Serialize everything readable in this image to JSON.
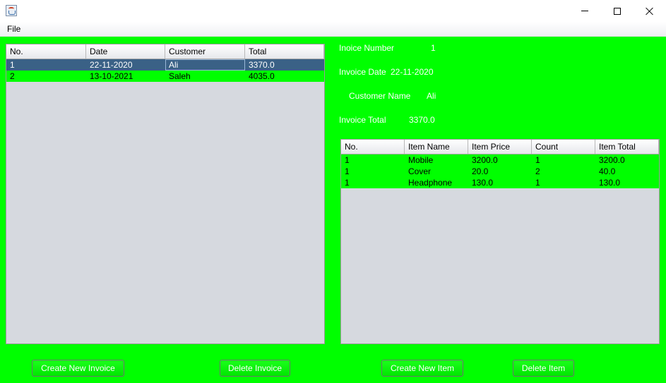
{
  "window": {
    "title": ""
  },
  "icons": {
    "app": "java-cup-icon",
    "minimize": "minimize-icon",
    "maximize": "maximize-icon",
    "close": "close-icon"
  },
  "colors": {
    "background": "#00ff00",
    "selection": "#3a6186",
    "table_bg": "#d6d9df",
    "label_text": "#ffffff"
  },
  "menu": {
    "file": "File"
  },
  "invoices_table": {
    "columns": [
      "No.",
      "Date",
      "Customer",
      "Total"
    ],
    "rows": [
      [
        "1",
        "22-11-2020",
        "Ali",
        "3370.0"
      ],
      [
        "2",
        "13-10-2021",
        "Saleh",
        "4035.0"
      ]
    ],
    "selected_row": 0
  },
  "invoice_details": {
    "number_label": "Inoice Number",
    "number_value": "1",
    "date_label": "Invoice Date",
    "date_value": "22-11-2020",
    "customer_label": "Customer Name",
    "customer_value": "Ali",
    "total_label": "Invoice Total",
    "total_value": "3370.0"
  },
  "items_table": {
    "columns": [
      "No.",
      "Item Name",
      "Item Price",
      "Count",
      "Item Total"
    ],
    "rows": [
      [
        "1",
        "Mobile",
        "3200.0",
        "1",
        "3200.0"
      ],
      [
        "1",
        "Cover",
        "20.0",
        "2",
        "40.0"
      ],
      [
        "1",
        "Headphone",
        "130.0",
        "1",
        "130.0"
      ]
    ]
  },
  "buttons": {
    "create_invoice": "Create New Invoice",
    "delete_invoice": "Delete Invoice",
    "create_item": "Create New Item",
    "delete_item": "Delete Item"
  }
}
